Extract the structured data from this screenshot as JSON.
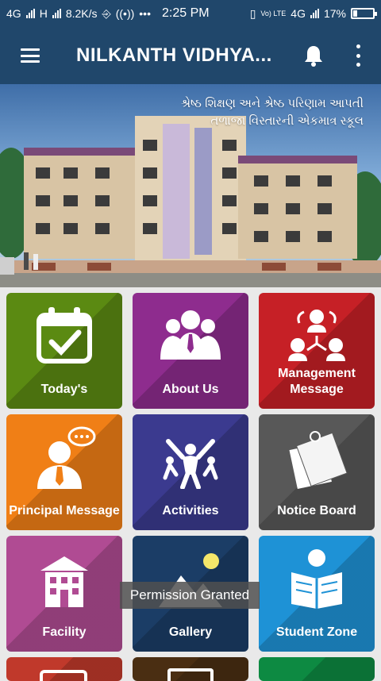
{
  "status": {
    "carrier1": "4G",
    "carrier2": "H",
    "speed": "8.2K/s",
    "dots": "•••",
    "time": "2:25 PM",
    "lte": "Vo) LTE",
    "network": "4G",
    "battery": "17%"
  },
  "appbar": {
    "title": "NILKANTH VIDHYA..."
  },
  "banner": {
    "line1": "શ્રેષ્ઠ શિક્ષણ અને શ્રેષ્ઠ પરિણામ આપતી",
    "line2": "તળાજા વિસ્તારની એકમાત્ર સ્કૂલ"
  },
  "tiles": [
    {
      "label": "Today's",
      "color": "#5b8a12",
      "icon": "calendar-check-icon"
    },
    {
      "label": "About Us",
      "color": "#8e2c8e",
      "icon": "group-people-icon"
    },
    {
      "label": "Management Message",
      "color": "#c62026",
      "icon": "team-network-icon"
    },
    {
      "label": "Principal Message",
      "color": "#f07f16",
      "icon": "speaker-person-icon"
    },
    {
      "label": "Activities",
      "color": "#3b3a8f",
      "icon": "activities-people-icon"
    },
    {
      "label": "Notice Board",
      "color": "#585858",
      "icon": "pinned-notes-icon"
    },
    {
      "label": "Facility",
      "color": "#b04b93",
      "icon": "building-icon"
    },
    {
      "label": "Gallery",
      "color": "#1b3d66",
      "icon": "picture-icon"
    },
    {
      "label": "Student Zone",
      "color": "#1e92d6",
      "icon": "reading-student-icon"
    }
  ],
  "bottom_tiles": [
    {
      "color": "#c0392b"
    },
    {
      "color": "#4a2e12"
    },
    {
      "color": "#0d8a42"
    }
  ],
  "toast": "Permission Granted"
}
